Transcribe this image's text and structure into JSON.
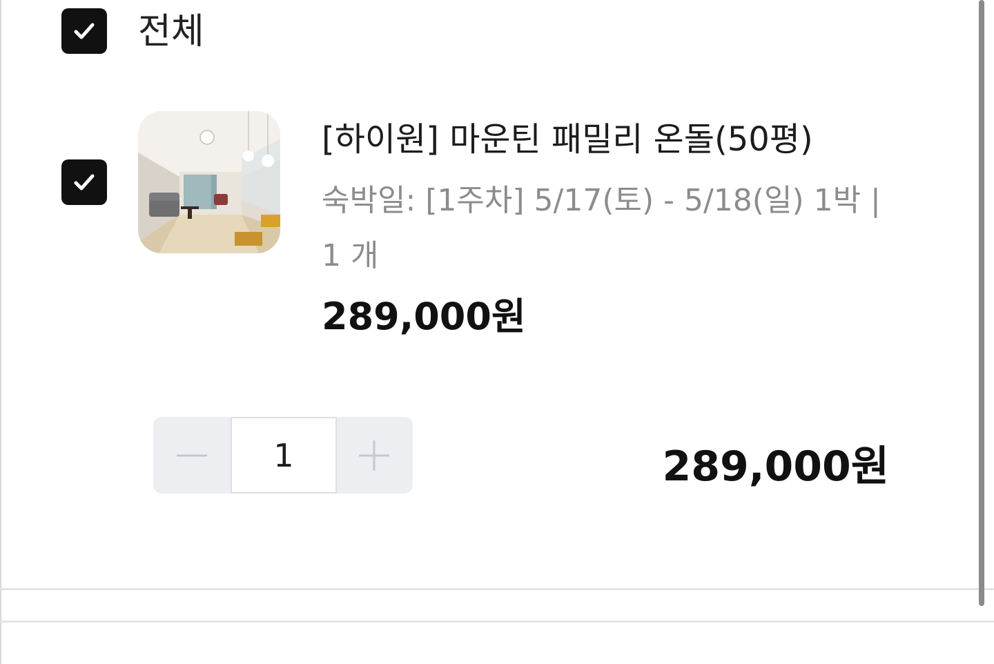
{
  "select_all": {
    "label": "전체",
    "checked": true
  },
  "item": {
    "checked": true,
    "thumbnail": "living-room-photo",
    "title": "[하이원] 마운틴 패밀리 온돌(50평)",
    "option": "숙박일: [1주차] 5/17(토) - 5/18(일) 1박 |",
    "quantity_text": "1 개",
    "unit_price": "289,000원",
    "quantity": "1",
    "total_price": "289,000원"
  },
  "colors": {
    "checkbox_fill": "#111111",
    "stepper_bg": "#eceef1",
    "muted_text": "#8c8c8c",
    "divider": "#e4e4e4"
  },
  "icons": {
    "check": "check-icon",
    "minus": "minus-icon",
    "plus": "plus-icon"
  }
}
